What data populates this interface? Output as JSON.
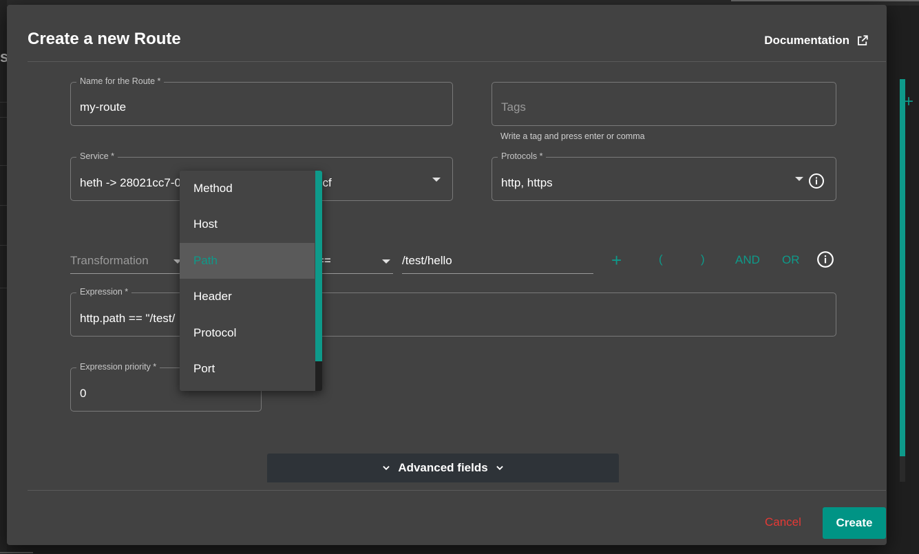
{
  "dialog": {
    "title": "Create a new Route",
    "documentation_label": "Documentation"
  },
  "form": {
    "name": {
      "label": "Name for the Route *",
      "value": "my-route"
    },
    "tags": {
      "placeholder": "Tags",
      "helper": "Write a tag and press enter or comma"
    },
    "service": {
      "label": "Service *",
      "value_start": "heth -> 28021cc7-0",
      "value_end": "dcf"
    },
    "protocols": {
      "label": "Protocols *",
      "value": "http, https"
    },
    "expression_builder": {
      "transformation_placeholder": "Transformation",
      "operator_value": "==",
      "path_value": "/test/hello",
      "add_symbol": "+",
      "open_paren": "(",
      "close_paren": ")",
      "and_label": "AND",
      "or_label": "OR"
    },
    "expression": {
      "label": "Expression *",
      "value": "http.path == \"/test/"
    },
    "expression_priority": {
      "label": "Expression priority *",
      "value": "0"
    }
  },
  "advanced_fields_label": "Advanced fields",
  "footer": {
    "cancel_label": "Cancel",
    "create_label": "Create"
  },
  "field_menu": {
    "items": [
      {
        "label": "Method",
        "selected": false
      },
      {
        "label": "Host",
        "selected": false
      },
      {
        "label": "Path",
        "selected": true
      },
      {
        "label": "Header",
        "selected": false
      },
      {
        "label": "Protocol",
        "selected": false
      },
      {
        "label": "Port",
        "selected": false
      }
    ]
  },
  "colors": {
    "accent": "#009485",
    "danger": "#e53935",
    "surface": "#424242"
  }
}
